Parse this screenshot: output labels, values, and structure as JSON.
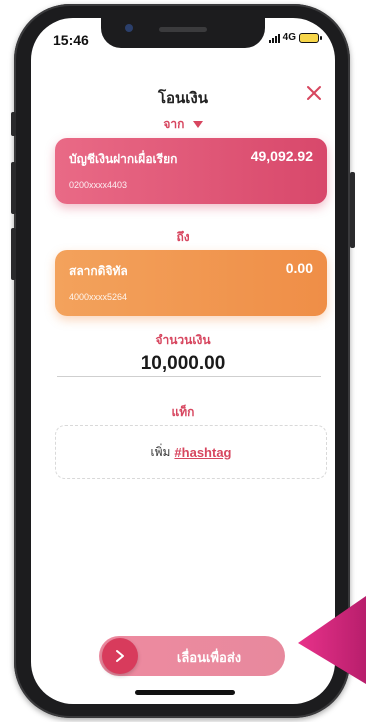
{
  "status_bar": {
    "time": "15:46",
    "network": "4G"
  },
  "header": {
    "title": "โอนเงิน"
  },
  "from": {
    "label": "จาก",
    "account_name": "บัญชีเงินฝากเผื่อเรียก",
    "balance": "49,092.92",
    "account_number": "0200xxxx4403"
  },
  "to": {
    "label": "ถึง",
    "account_name": "สลากดิจิทัล",
    "balance": "0.00",
    "account_number": "4000xxxx5264"
  },
  "amount": {
    "label": "จำนวนเงิน",
    "value": "10,000.00"
  },
  "tag": {
    "label": "แท็ก",
    "add_text": "เพิ่ม",
    "hashtag_text": "#hashtag"
  },
  "action": {
    "slide_label": "เลื่อนเพื่อส่ง"
  },
  "colors": {
    "accent": "#d7465f",
    "from_card": "#e0577a",
    "to_card": "#f19a53",
    "slider": "#ec879c",
    "pointer": "#e8328a"
  }
}
